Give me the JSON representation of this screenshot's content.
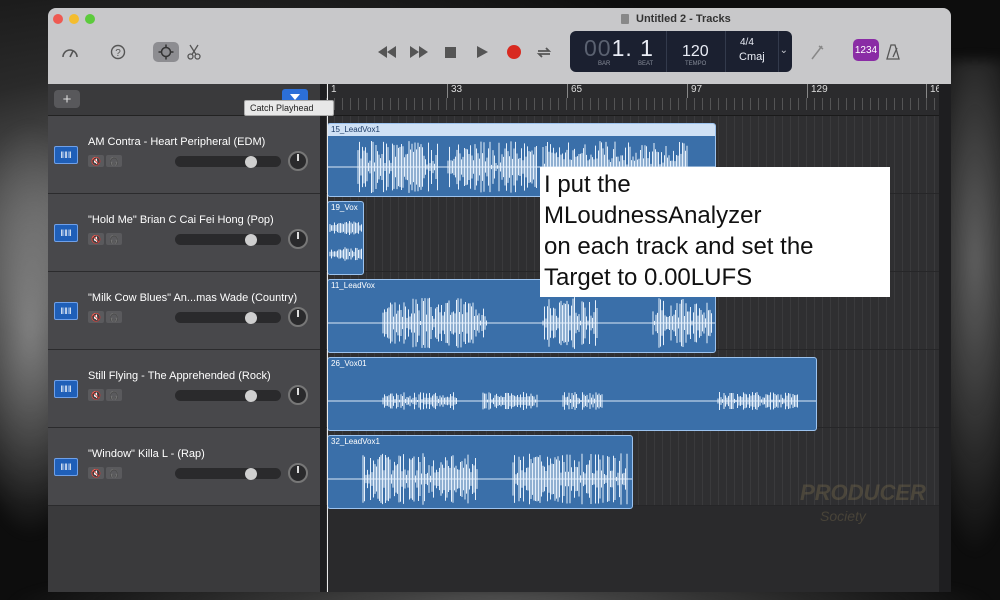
{
  "window": {
    "title": "Untitled 2 - Tracks"
  },
  "toolbar": {
    "icons": [
      "library-icon",
      "help-icon",
      "smart-controls-icon",
      "editors-icon"
    ],
    "transport": [
      "rewind-icon",
      "fast-forward-icon",
      "stop-icon",
      "play-icon",
      "record-icon",
      "cycle-icon"
    ],
    "lcd": {
      "bar_dim": "00",
      "bar": "1.",
      "beat": "1",
      "bar_label": "BAR",
      "beat_label": "BEAT",
      "tempo": "120",
      "tempo_label": "TEMPO",
      "time_signature": "4/4",
      "key": "Cmaj"
    },
    "count_in": "1234"
  },
  "track_area": {
    "add_label": "+",
    "tooltip": "Catch Playhead",
    "ruler": [
      "1",
      "33",
      "65",
      "97",
      "129",
      "16"
    ]
  },
  "tracks": [
    {
      "name": "AM Contra - Heart Peripheral (EDM)",
      "region": "15_LeadVox1",
      "volume": 0.72
    },
    {
      "name": "\"Hold Me\" Brian C Cai Fei Hong (Pop)",
      "region": "19_Vox",
      "volume": 0.72
    },
    {
      "name": "\"Milk Cow Blues\" An...mas Wade (Country)",
      "region": "11_LeadVox",
      "volume": 0.72
    },
    {
      "name": "Still Flying - The Apprehended (Rock)",
      "region": "26_Vox01",
      "volume": 0.72
    },
    {
      "name": "\"Window\" Killa L - (Rap)",
      "region": "32_LeadVox1",
      "volume": 0.72
    }
  ],
  "annotation": {
    "lines": [
      "I put the",
      "MLoudnessAnalyzer",
      "on each track and set the",
      "Target to 0.00LUFS"
    ]
  },
  "watermark": {
    "line1": "PRODUCER",
    "line2": "Society"
  },
  "colors": {
    "region": "#3a6fa9",
    "record": "#d82a20",
    "count_in": "#8a2ca5",
    "filter": "#2c6fd8"
  }
}
